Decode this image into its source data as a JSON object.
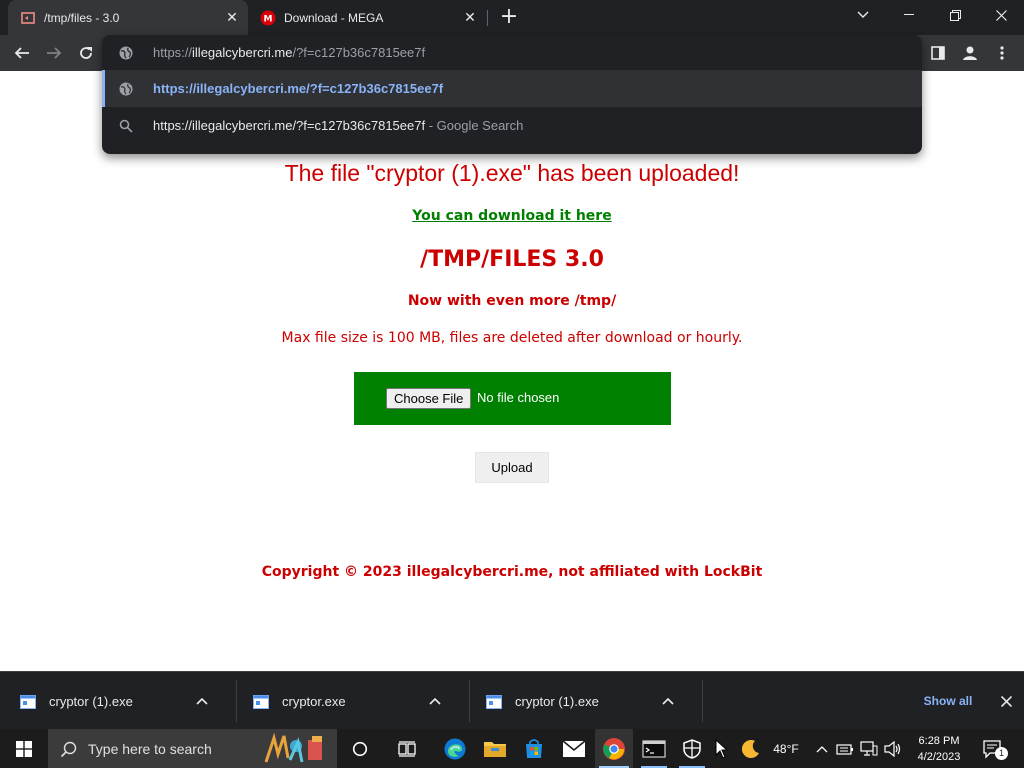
{
  "browser": {
    "tabs": [
      {
        "title": "/tmp/files - 3.0",
        "active": true
      },
      {
        "title": "Download - MEGA",
        "active": false
      }
    ],
    "omnibox": {
      "url_prefix": "https://",
      "url_host": "illegalcybercri.me",
      "url_rest": "/?f=c127b36c7815ee7f",
      "suggestion_selected": "https://illegalcybercri.me/?f=c127b36c7815ee7f",
      "suggestion_search": "https://illegalcybercri.me/?f=c127b36c7815ee7f",
      "suggestion_search_suffix": " - Google Search"
    }
  },
  "page": {
    "uploaded_message": "The file \"cryptor (1).exe\" has been uploaded!",
    "download_link": "You can download it here",
    "brand": "/TMP/FILES 3.0",
    "tagline": "Now with even more /tmp/",
    "limits": "Max file size is 100 MB, files are deleted after download or hourly.",
    "choose_file_label": "Choose File",
    "no_file_label": "No file chosen",
    "upload_label": "Upload",
    "copyright": "Copyright © 2023 illegalcybercri.me, not affiliated with LockBit"
  },
  "downloads": {
    "items": [
      {
        "name": "cryptor (1).exe"
      },
      {
        "name": "cryptor.exe"
      },
      {
        "name": "cryptor (1).exe"
      }
    ],
    "show_all": "Show all"
  },
  "taskbar": {
    "search_placeholder": "Type here to search",
    "weather": "48°F",
    "time": "6:28 PM",
    "date": "4/2/2023",
    "notification_count": "1"
  },
  "colors": {
    "accent_red": "#cc0000",
    "green": "#008000",
    "chrome_dark": "#202124",
    "link_blue": "#8ab4f8"
  }
}
